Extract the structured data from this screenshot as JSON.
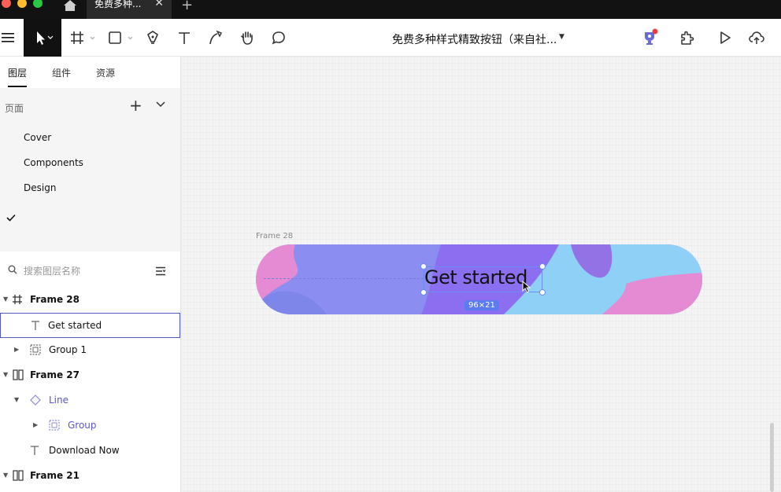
{
  "tab": {
    "title": "免费多种...",
    "close": "✕",
    "new": "+"
  },
  "toolbar": {
    "doc_title": "免费多种样式精致按钮（来自社...",
    "doc_chevron": "▼"
  },
  "panel": {
    "tabs": [
      {
        "label": "图层"
      },
      {
        "label": "组件"
      },
      {
        "label": "资源"
      }
    ],
    "pages_header": "页面",
    "add": "+",
    "pages": [
      {
        "label": "Cover"
      },
      {
        "label": "Components"
      },
      {
        "label": "Design"
      }
    ],
    "search_placeholder": "搜索图层名称",
    "layers": [
      {
        "label": "Frame 28"
      },
      {
        "label": "Get started"
      },
      {
        "label": "Group 1"
      },
      {
        "label": "Frame 27"
      },
      {
        "label": "Line"
      },
      {
        "label": "Group"
      },
      {
        "label": "Download Now"
      },
      {
        "label": "Frame 21"
      }
    ]
  },
  "canvas": {
    "frame_label": "Frame 28",
    "button_text": "Get started",
    "size_badge": "96×21"
  }
}
